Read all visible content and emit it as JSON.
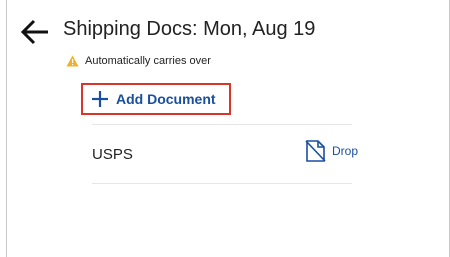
{
  "header": {
    "title": "Shipping Docs: Mon, Aug 19",
    "back_icon": "arrow-left-icon"
  },
  "notice": {
    "icon": "warning-icon",
    "text": "Automatically carries over",
    "icon_color": "#f2b02a"
  },
  "add_button": {
    "label": "Add Document",
    "icon": "plus-icon",
    "highlight_color": "#d8362b",
    "accent_color": "#1a4fa0"
  },
  "documents": [
    {
      "name": "USPS",
      "action_label": "Drop",
      "action_icon": "document-drop-icon"
    }
  ]
}
